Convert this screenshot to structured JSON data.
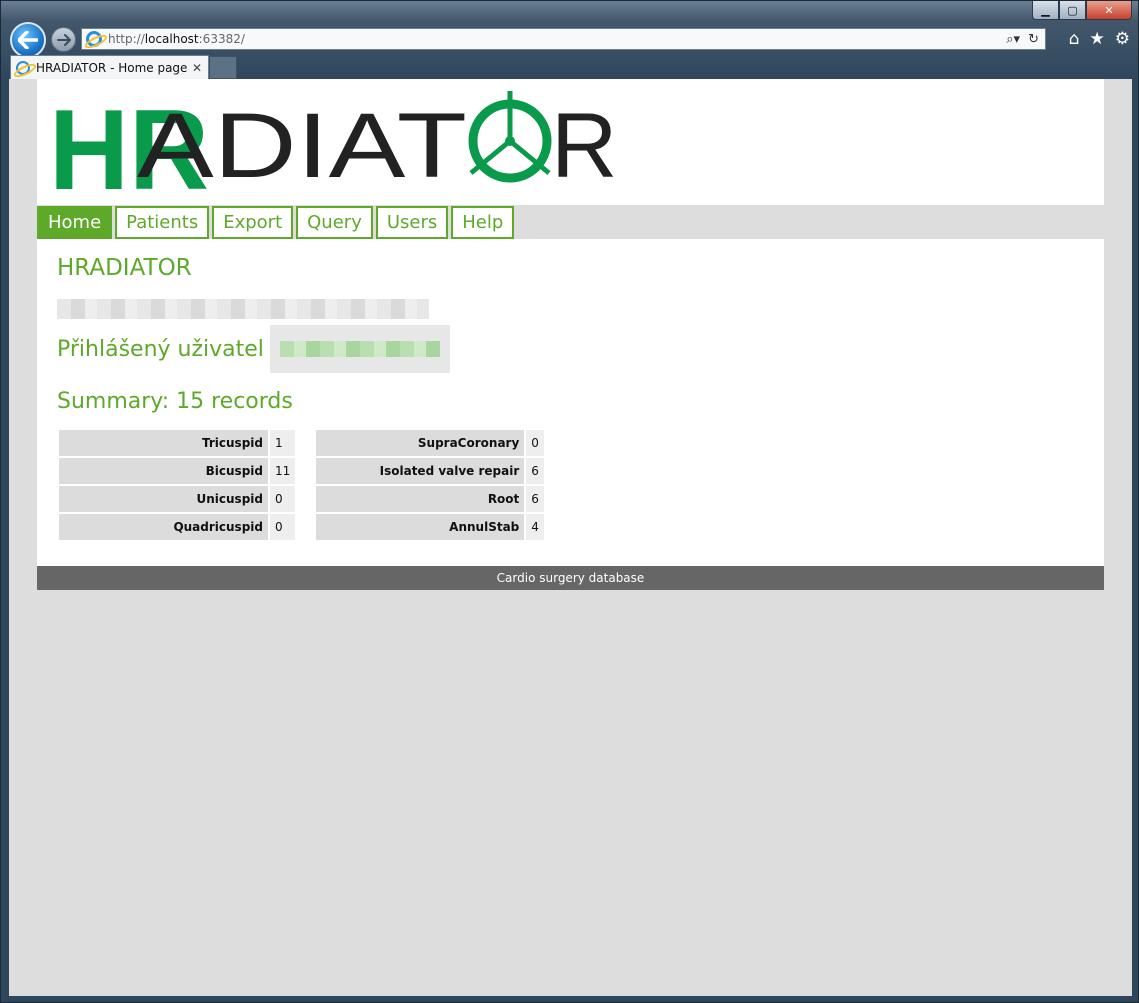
{
  "browser": {
    "url_prefix": "http://",
    "url_host": "localhost",
    "url_rest": ":63382/",
    "tab_title": "HRADIATOR - Home page",
    "tab_close": "✕",
    "caption": {
      "minimize": "▁",
      "maximize": "▢",
      "close": "✕"
    }
  },
  "logo": {
    "hr_text": "HR",
    "rest_text": "ADIAT",
    "end_text": "R",
    "hr_color": "#0a9a4b",
    "text_color": "#222222"
  },
  "menu": {
    "items": [
      {
        "label": "Home",
        "active": true
      },
      {
        "label": "Patients",
        "active": false
      },
      {
        "label": "Export",
        "active": false
      },
      {
        "label": "Query",
        "active": false
      },
      {
        "label": "Users",
        "active": false
      },
      {
        "label": "Help",
        "active": false
      }
    ],
    "accent_color": "#5ea92a"
  },
  "content": {
    "title": "HRADIATOR",
    "user_label": "Přihlášený uživatel",
    "summary_title": "Summary: 15 records",
    "table_left": [
      {
        "label": "Tricuspid",
        "value": "1"
      },
      {
        "label": "Bicuspid",
        "value": "11"
      },
      {
        "label": "Unicuspid",
        "value": "0"
      },
      {
        "label": "Quadricuspid",
        "value": "0"
      }
    ],
    "table_right": [
      {
        "label": "SupraCoronary",
        "value": "0"
      },
      {
        "label": "Isolated valve repair",
        "value": "6"
      },
      {
        "label": "Root",
        "value": "6"
      },
      {
        "label": "AnnulStab",
        "value": "4"
      }
    ]
  },
  "footer": {
    "text": "Cardio surgery database"
  }
}
